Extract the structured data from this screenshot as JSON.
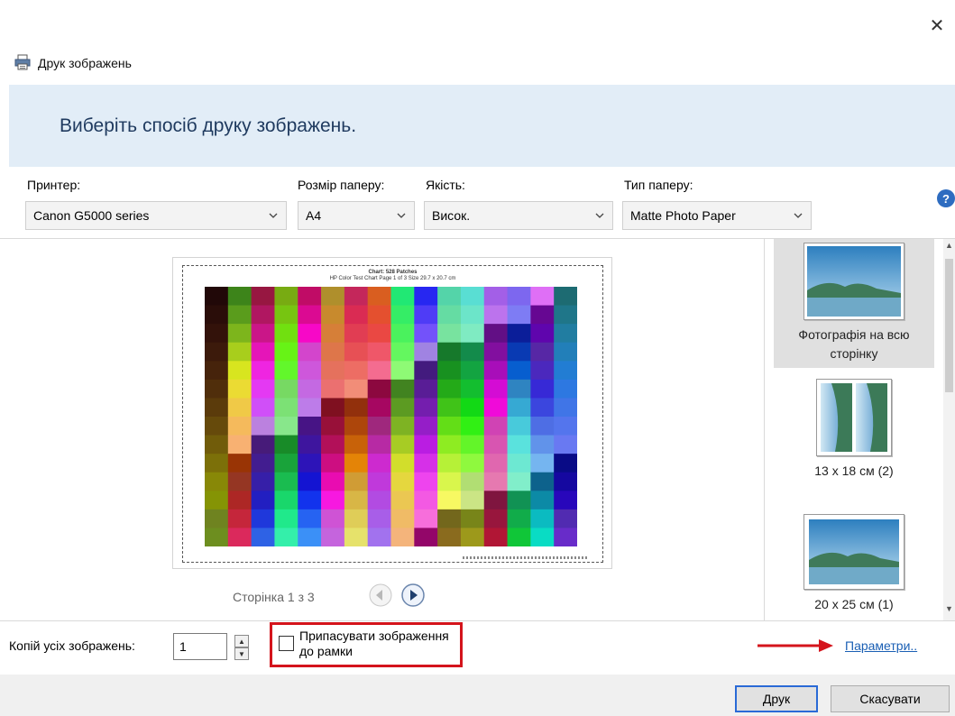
{
  "window": {
    "title": "Друк зображень",
    "close_symbol": "✕"
  },
  "banner": {
    "heading": "Виберіть спосіб друку зображень."
  },
  "printer": {
    "label": "Принтер:",
    "value": "Canon G5000 series"
  },
  "paper_size": {
    "label": "Розмір паперу:",
    "value": "A4"
  },
  "quality": {
    "label": "Якість:",
    "value": "Висок."
  },
  "paper_type": {
    "label": "Тип паперу:",
    "value": "Matte Photo Paper"
  },
  "help": {
    "symbol": "?"
  },
  "preview": {
    "page_info": "Сторінка 1 з 3",
    "chart_title": "Chart: 528 Patches",
    "chart_subtitle": "HP Color Test Chart  Page 1 of 3  Size 29.7 x 20.7 cm",
    "columns": 16,
    "rows": 14
  },
  "layouts": [
    {
      "label": "Фотографія на всю сторінку",
      "selected": true
    },
    {
      "label": "13 x 18 см (2)",
      "selected": false
    },
    {
      "label": "20 x 25 см (1)",
      "selected": false
    }
  ],
  "copies": {
    "label": "Копій усіх зображень:",
    "value": "1"
  },
  "fit": {
    "label": "Припасувати зображення до рамки",
    "checked": false
  },
  "params_link": "Параметри..",
  "buttons": {
    "print": "Друк",
    "cancel": "Скасувати"
  },
  "colors": {
    "accent": "#2a6ad6",
    "highlight_box": "#d4141c",
    "banner_bg": "#e2edf7"
  }
}
